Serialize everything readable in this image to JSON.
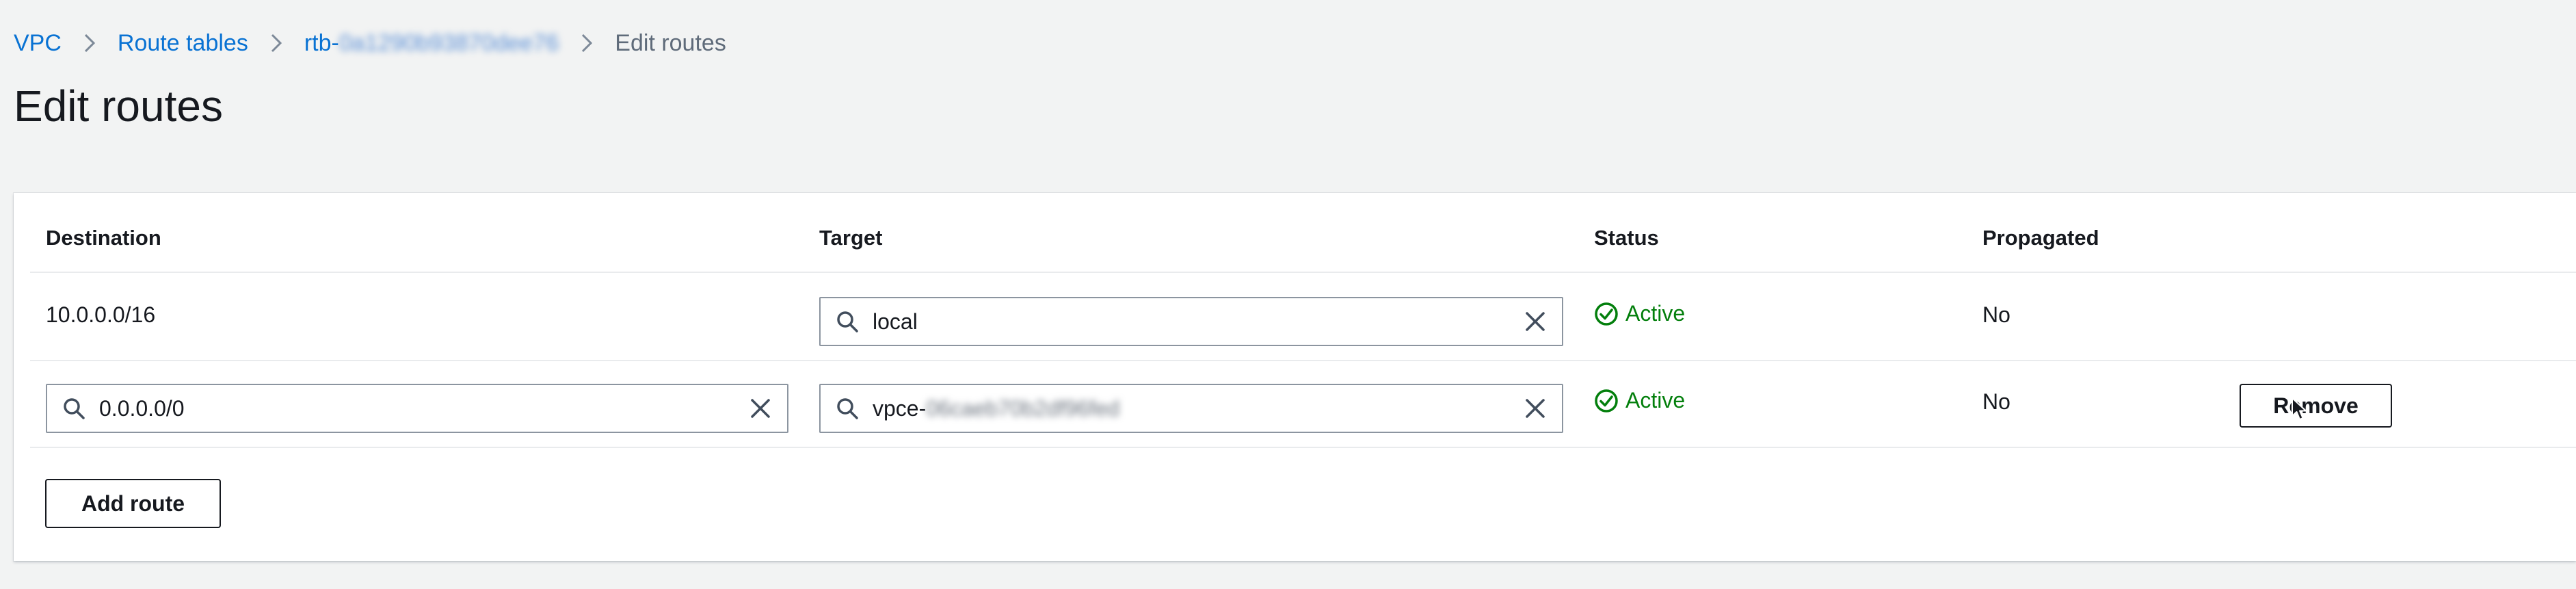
{
  "breadcrumb": {
    "items": [
      {
        "label": "VPC"
      },
      {
        "label": "Route tables"
      },
      {
        "prefix": "rtb-",
        "masked": "0a1290b93870dee76"
      },
      {
        "label": "Edit routes"
      }
    ]
  },
  "page_title": "Edit routes",
  "table": {
    "columns": [
      "Destination",
      "Target",
      "Status",
      "Propagated"
    ],
    "rows": [
      {
        "destination": "10.0.0.0/16",
        "target": "local",
        "status": "Active",
        "propagated": "No"
      },
      {
        "destination": "0.0.0.0/0",
        "target_prefix": "vpce-",
        "target_masked": "06caeb70b2df96fed",
        "status": "Active",
        "propagated": "No",
        "remove_label": "Remove"
      }
    ]
  },
  "add_route_label": "Add route",
  "colors": {
    "link": "#0972d3",
    "success": "#037f0c",
    "text": "#16191f",
    "page_bg": "#f2f3f3"
  },
  "icons": [
    "chevron-right-icon",
    "search-icon",
    "clear-icon",
    "status-success-icon",
    "mouse-cursor-icon"
  ]
}
